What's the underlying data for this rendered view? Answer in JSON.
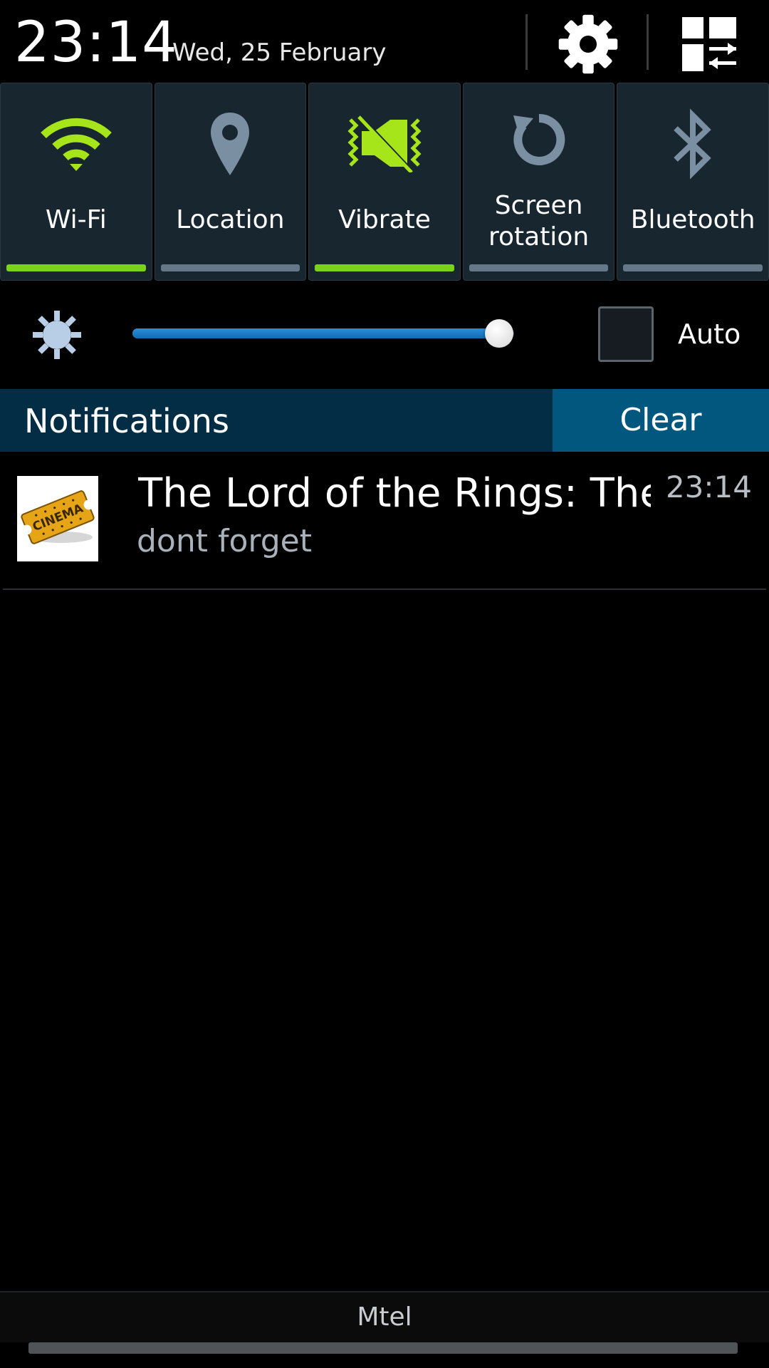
{
  "header": {
    "time": "23:14",
    "date": "Wed, 25 February",
    "settings_icon": "gear-icon",
    "edit_icon": "grid-edit-icon"
  },
  "toggles": [
    {
      "label": "Wi-Fi",
      "icon": "wifi-icon",
      "on": true
    },
    {
      "label": "Location",
      "icon": "location-pin-icon",
      "on": false
    },
    {
      "label": "Vibrate",
      "icon": "vibrate-icon",
      "on": true
    },
    {
      "label_line1": "Screen",
      "label_line2": "rotation",
      "icon": "rotate-icon",
      "on": false
    },
    {
      "label": "Bluetooth",
      "icon": "bluetooth-icon",
      "on": false
    }
  ],
  "brightness": {
    "level_percent": 96,
    "auto_label": "Auto",
    "auto_checked": false,
    "icon": "brightness-sun-icon"
  },
  "notifications": {
    "title": "Notifications",
    "clear_label": "Clear",
    "items": [
      {
        "title": "The Lord of the Rings: The..",
        "text": "dont forget",
        "time": "23:14",
        "thumb_icon": "cinema-ticket-icon",
        "thumb_text": "CINEMA"
      }
    ]
  },
  "carrier": "Mtel",
  "colors": {
    "accent_on": "#7bd21a",
    "accent_off": "#647887",
    "tile_bg": "#182630",
    "notif_header_bg": "#022d45",
    "clear_bg": "#02577f",
    "slider_blue": "#1e7fc8"
  }
}
